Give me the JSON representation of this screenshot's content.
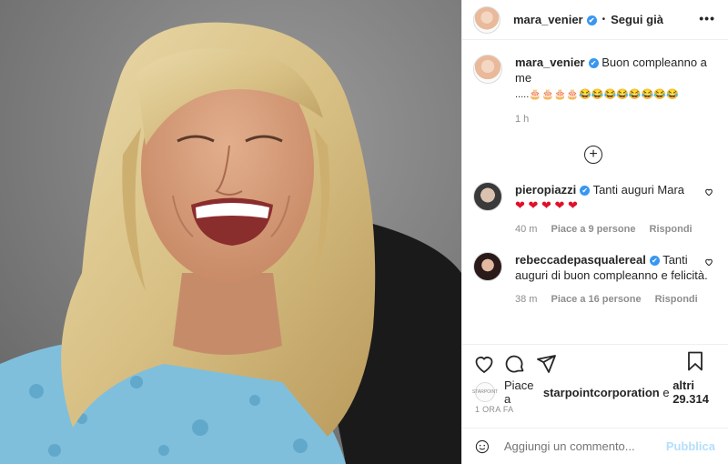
{
  "header": {
    "username": "mara_venier",
    "verified_badge": "✔",
    "separator": "•",
    "follow_label": "Segui già",
    "more_icon": "•••"
  },
  "caption": {
    "username": "mara_venier",
    "text": "Buon compleanno a me",
    "emoji_line": ".....🎂🎂🎂🎂😂😂😂😂😂😂😂😂",
    "time": "1 h"
  },
  "load_more_icon": "+",
  "comments": [
    {
      "username": "pieropiazzi",
      "text": "Tanti auguri Mara",
      "hearts": "❤ ❤ ❤ ❤ ❤",
      "time": "40 m",
      "likes": "Piace a 9 persone",
      "reply": "Rispondi"
    },
    {
      "username": "rebeccadepasqualereal",
      "text": "Tanti auguri di buon compleanno e felicità.",
      "time": "38 m",
      "likes": "Piace a 16 persone",
      "reply": "Rispondi"
    }
  ],
  "likes": {
    "prefix": "Piace a",
    "user": "starpointcorporation",
    "middle": "e",
    "others": "altri 29.314",
    "avatar_text": "STARPOINT"
  },
  "timestamp": "1 ORA FA",
  "add_comment": {
    "placeholder": "Aggiungi un commento...",
    "publish_label": "Pubblica"
  }
}
